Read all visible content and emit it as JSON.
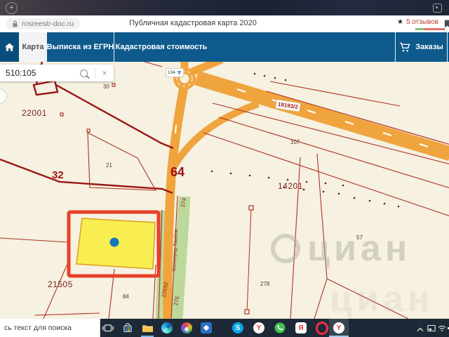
{
  "browser": {
    "new_tab": "+",
    "url": "rosreestr-doc.ru",
    "title": "Публичная кадастровая карта 2020",
    "reviews_star": "★",
    "reviews_text": "5 отзывов"
  },
  "nav": {
    "tab_map": "Карта",
    "tab_egrn": "Выписка из ЕГРН",
    "tab_value": "Кадастровая стоимость",
    "orders": "Заказы"
  },
  "map_search": {
    "value": "510:105",
    "clear": "×"
  },
  "map": {
    "labels": {
      "l30": "30",
      "l22001": "22001",
      "l21": "21",
      "l32": "32",
      "l64": "64",
      "l107": "107",
      "l14201": "14201",
      "l57": "57",
      "l278": "278",
      "l21505": "21505",
      "l84": "84",
      "l274": "274",
      "l276": "276",
      "l22692": "22692"
    },
    "badge_road": "18193/2",
    "badge_roundabout": "134",
    "street": "Волгоград-Тамбов",
    "watermark": "циан"
  },
  "taskbar": {
    "search_text": "сь текст для поиска",
    "glyphs": {
      "skype": "S",
      "yandex": "Я",
      "ybrowser": "Y",
      "ybrowser2": "Y"
    }
  },
  "colors": {
    "nav_blue": "#0e5a8c",
    "road_orange": "#f0a43e",
    "line_red": "#ad3226",
    "boundary_red": "#9a1616",
    "selection_red": "#e8402a",
    "parcel_yellow": "#f8ee52",
    "point_blue": "#1378bd",
    "map_bg": "#f6f1e0",
    "green": "#bcd89a"
  }
}
